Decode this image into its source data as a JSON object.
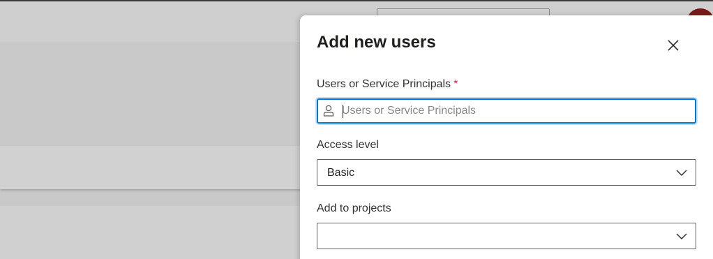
{
  "panel": {
    "title": "Add new users",
    "close_icon": "close-icon"
  },
  "users_field": {
    "label": "Users or Service Principals",
    "required_marker": "*",
    "placeholder": "Users or Service Principals",
    "value": "",
    "icon": "person-icon"
  },
  "access_level": {
    "label": "Access level",
    "value": "Basic",
    "icon": "chevron-down-icon"
  },
  "projects": {
    "label": "Add to projects",
    "value": "",
    "icon": "chevron-down-icon"
  },
  "colors": {
    "focus_border": "#0078d4",
    "required": "#c4314b",
    "avatar": "#7a1a1a"
  }
}
